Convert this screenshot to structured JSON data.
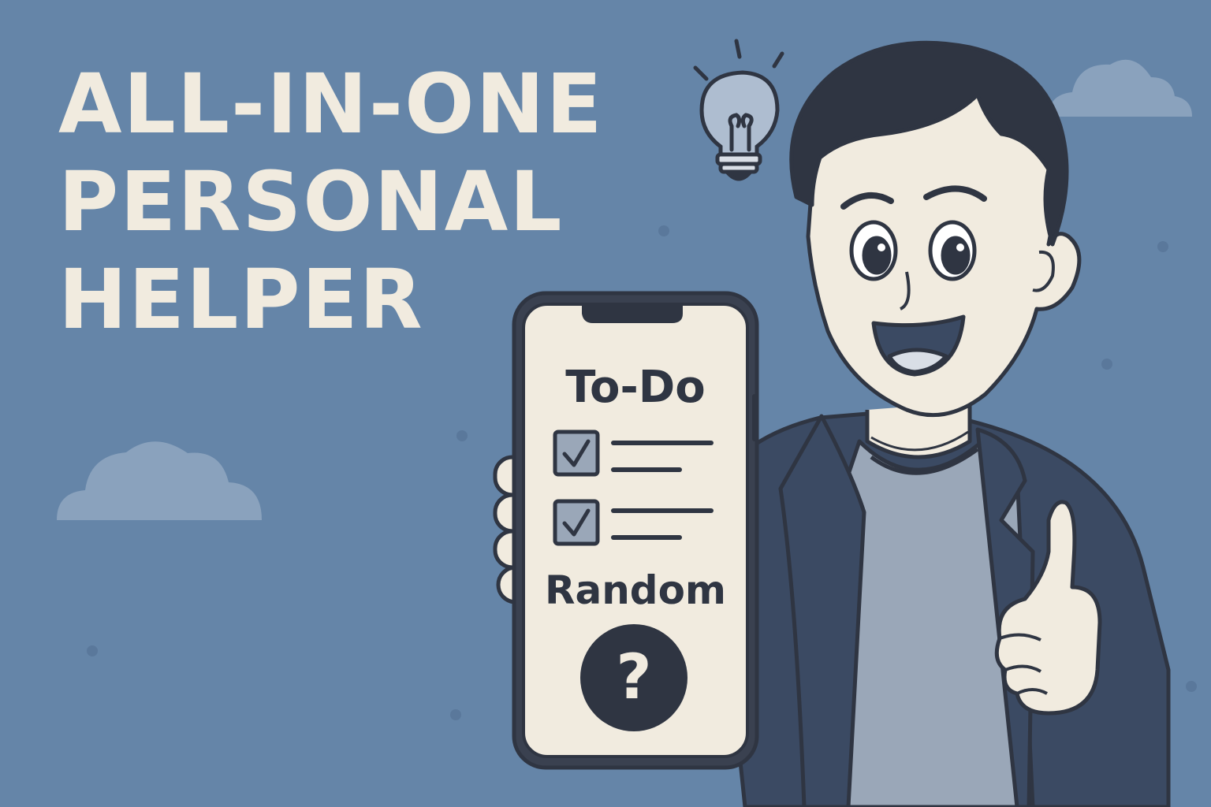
{
  "headline": {
    "line1": "ALL-IN-ONE",
    "line2": "PERSONAL",
    "line3": "HELPER"
  },
  "phone": {
    "todo_title": "To-Do",
    "random_title": "Random",
    "random_symbol": "?",
    "checklist": [
      {
        "checked": true
      },
      {
        "checked": true
      }
    ]
  },
  "icons": [
    "lightbulb-icon",
    "check-icon",
    "question-mark-icon",
    "cloud-icon"
  ],
  "colors": {
    "background": "#6585a8",
    "headline_text": "#f1ebdf",
    "outline": "#2f3542",
    "jacket": "#3b4a63",
    "shirt": "#9aa7b8",
    "skin": "#f1ebdf",
    "hair": "#2f3542"
  }
}
